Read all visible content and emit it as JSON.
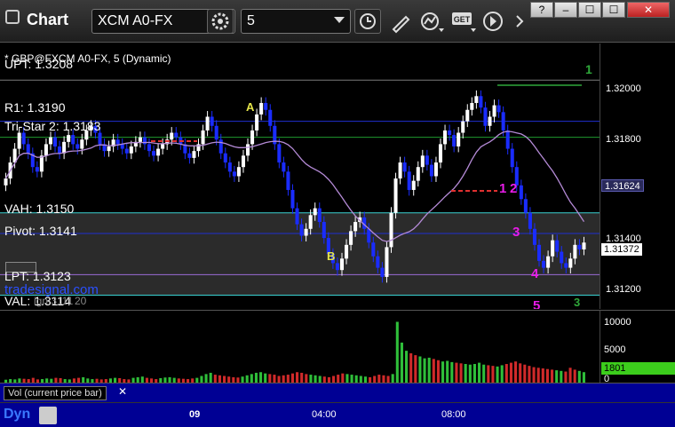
{
  "window": {
    "title": "Chart",
    "symbol": "XCM A0-FX",
    "interval": "5",
    "controls": {
      "help": "?",
      "minimize": "–",
      "maximize": "☐",
      "close": "✕"
    }
  },
  "chart": {
    "header": "* GBP@FXCM A0-FX, 5 (Dynamic)",
    "watermark": "tradesignal.com",
    "levels": {
      "upt": "UPT: 1.3208",
      "r1": "R1: 1.3190",
      "tristar": "Tri-Star 2: 1.3183",
      "vah": "VAH: 1.3150",
      "pivot": "Pivot: 1.3141",
      "lpt": "LPT: 1.3123",
      "val": "VAL: 1.3114",
      "extra": "ign 3111",
      "extra2": "20"
    },
    "price_ticks": [
      "1.32000",
      "1.31800",
      "1.31400",
      "1.31200"
    ],
    "price_tag_ma": "1.31624",
    "price_tag_last": "1.31372",
    "annotations": {
      "a": "A",
      "b": "B",
      "n1": "1",
      "n2": "2",
      "n3": "3",
      "n4": "4",
      "n5": "5",
      "green1": "1",
      "green3": "3"
    },
    "colors": {
      "up_bar": "#ffffff",
      "down_bar": "#1a2cff",
      "ma": "#b48ad6",
      "level_blue": "#1f2fd0",
      "level_green": "#1f9a2f",
      "level_cyan": "#3ad2d2",
      "level_purple": "#9a6bd6",
      "magenta": "#e81ce8",
      "yellow": "#e6e64a"
    }
  },
  "volume": {
    "label": "Vol (current price bar)",
    "ticks": [
      "10000",
      "5000",
      "0"
    ],
    "current_tag": "1801"
  },
  "time_axis": {
    "labels": [
      "09",
      "04:00",
      "08:00"
    ],
    "logo": "Dyn"
  },
  "chart_data": {
    "type": "candlestick",
    "title": "* GBP@FXCM A0-FX, 5 (Dynamic)",
    "ylim": [
      1.3108,
      1.3224
    ],
    "price_ticks": [
      1.32,
      1.318,
      1.314,
      1.312
    ],
    "levels": [
      {
        "name": "UPT",
        "value": 1.3208
      },
      {
        "name": "R1",
        "value": 1.319
      },
      {
        "name": "Tri-Star 2",
        "value": 1.3183
      },
      {
        "name": "VAH",
        "value": 1.315
      },
      {
        "name": "Pivot",
        "value": 1.3141
      },
      {
        "name": "LPT",
        "value": 1.3123
      },
      {
        "name": "VAL",
        "value": 1.3114
      }
    ],
    "close": [
      1.3165,
      1.3172,
      1.3178,
      1.3185,
      1.318,
      1.3176,
      1.317,
      1.3168,
      1.3175,
      1.318,
      1.3183,
      1.3179,
      1.3176,
      1.3181,
      1.3184,
      1.318,
      1.3178,
      1.3182,
      1.3186,
      1.3188,
      1.3185,
      1.318,
      1.3177,
      1.3179,
      1.3182,
      1.318,
      1.3178,
      1.3176,
      1.3179,
      1.3181,
      1.3183,
      1.318,
      1.3177,
      1.3175,
      1.3178,
      1.318,
      1.3182,
      1.3185,
      1.3183,
      1.318,
      1.3176,
      1.3174,
      1.3177,
      1.318,
      1.3186,
      1.3192,
      1.3188,
      1.3182,
      1.3176,
      1.3172,
      1.3168,
      1.3166,
      1.317,
      1.3175,
      1.318,
      1.3186,
      1.3193,
      1.3198,
      1.3195,
      1.3188,
      1.318,
      1.3172,
      1.3168,
      1.316,
      1.3152,
      1.3145,
      1.314,
      1.3143,
      1.3149,
      1.3152,
      1.3146,
      1.3139,
      1.3132,
      1.3128,
      1.3125,
      1.313,
      1.3136,
      1.3142,
      1.3146,
      1.3148,
      1.3143,
      1.3137,
      1.3131,
      1.3126,
      1.3122,
      1.3135,
      1.315,
      1.3165,
      1.3172,
      1.3168,
      1.316,
      1.3164,
      1.317,
      1.3175,
      1.3171,
      1.3166,
      1.3172,
      1.318,
      1.3186,
      1.3184,
      1.3179,
      1.3185,
      1.319,
      1.3195,
      1.3198,
      1.3201,
      1.3196,
      1.3188,
      1.3192,
      1.3197,
      1.3194,
      1.3186,
      1.3178,
      1.317,
      1.3162,
      1.3156,
      1.315,
      1.3143,
      1.3136,
      1.3129,
      1.3126,
      1.3131,
      1.3138,
      1.3133,
      1.3128,
      1.3126,
      1.313,
      1.3136,
      1.3134,
      1.3137
    ],
    "volume": [
      600,
      700,
      650,
      800,
      750,
      700,
      900,
      650,
      700,
      800,
      750,
      900,
      850,
      700,
      650,
      800,
      900,
      1000,
      800,
      700,
      750,
      650,
      700,
      800,
      900,
      850,
      700,
      650,
      900,
      1000,
      1100,
      900,
      800,
      700,
      850,
      950,
      1000,
      900,
      800,
      750,
      700,
      800,
      900,
      1200,
      1500,
      1700,
      1400,
      1300,
      1200,
      1100,
      1000,
      950,
      1100,
      1300,
      1500,
      1700,
      1800,
      1600,
      1500,
      1400,
      1200,
      1300,
      1400,
      1600,
      1800,
      1700,
      1500,
      1400,
      1300,
      1200,
      1100,
      1000,
      1200,
      1400,
      1600,
      1500,
      1400,
      1300,
      1200,
      1100,
      1000,
      1200,
      1400,
      1300,
      1200,
      1500,
      9800,
      6500,
      5200,
      4800,
      4500,
      4300,
      4000,
      4100,
      3900,
      3700,
      3500,
      3600,
      3400,
      3300,
      3200,
      3100,
      3000,
      3100,
      3300,
      3000,
      2900,
      2800,
      2700,
      2900,
      3100,
      3300,
      3500,
      3200,
      3000,
      2800,
      2600,
      2500,
      2400,
      2300,
      2200,
      2100,
      2000,
      1900,
      2500,
      2200,
      2000,
      1801
    ],
    "volume_ylim": [
      0,
      11000
    ]
  }
}
